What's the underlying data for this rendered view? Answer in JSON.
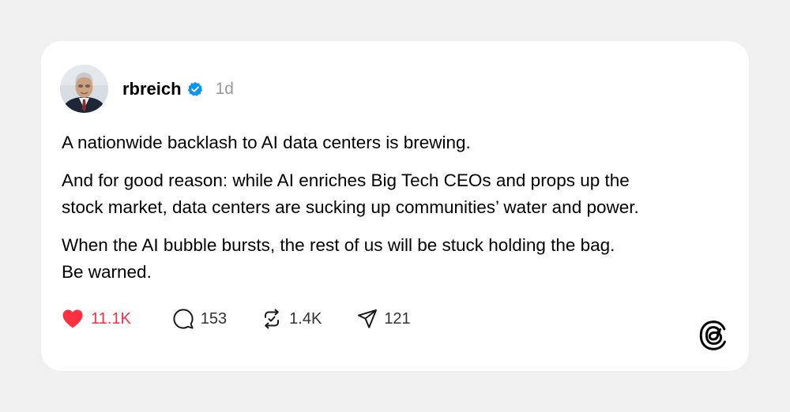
{
  "post": {
    "username": "rbreich",
    "timestamp": "1d",
    "paragraphs": [
      [
        "A nationwide backlash to AI data centers is brewing."
      ],
      [
        "And for good reason: while AI enriches Big Tech CEOs and props up the",
        "stock market, data centers are sucking up communities’ water and power."
      ],
      [
        "When the AI bubble bursts, the rest of us will be stuck holding the bag.",
        "Be warned."
      ]
    ]
  },
  "actions": {
    "likes": "11.1K",
    "replies": "153",
    "reposts": "1.4K",
    "shares": "121"
  },
  "icons": {
    "verified": "verified-badge-icon",
    "like": "heart-icon",
    "reply": "speech-bubble-icon",
    "repost": "repost-icon",
    "share": "send-icon",
    "brand": "threads-logo-icon"
  },
  "colors": {
    "background": "#f0f0f0",
    "card": "#ffffff",
    "like": "#ff3040",
    "verified": "#0095f6",
    "muted": "#999999"
  }
}
